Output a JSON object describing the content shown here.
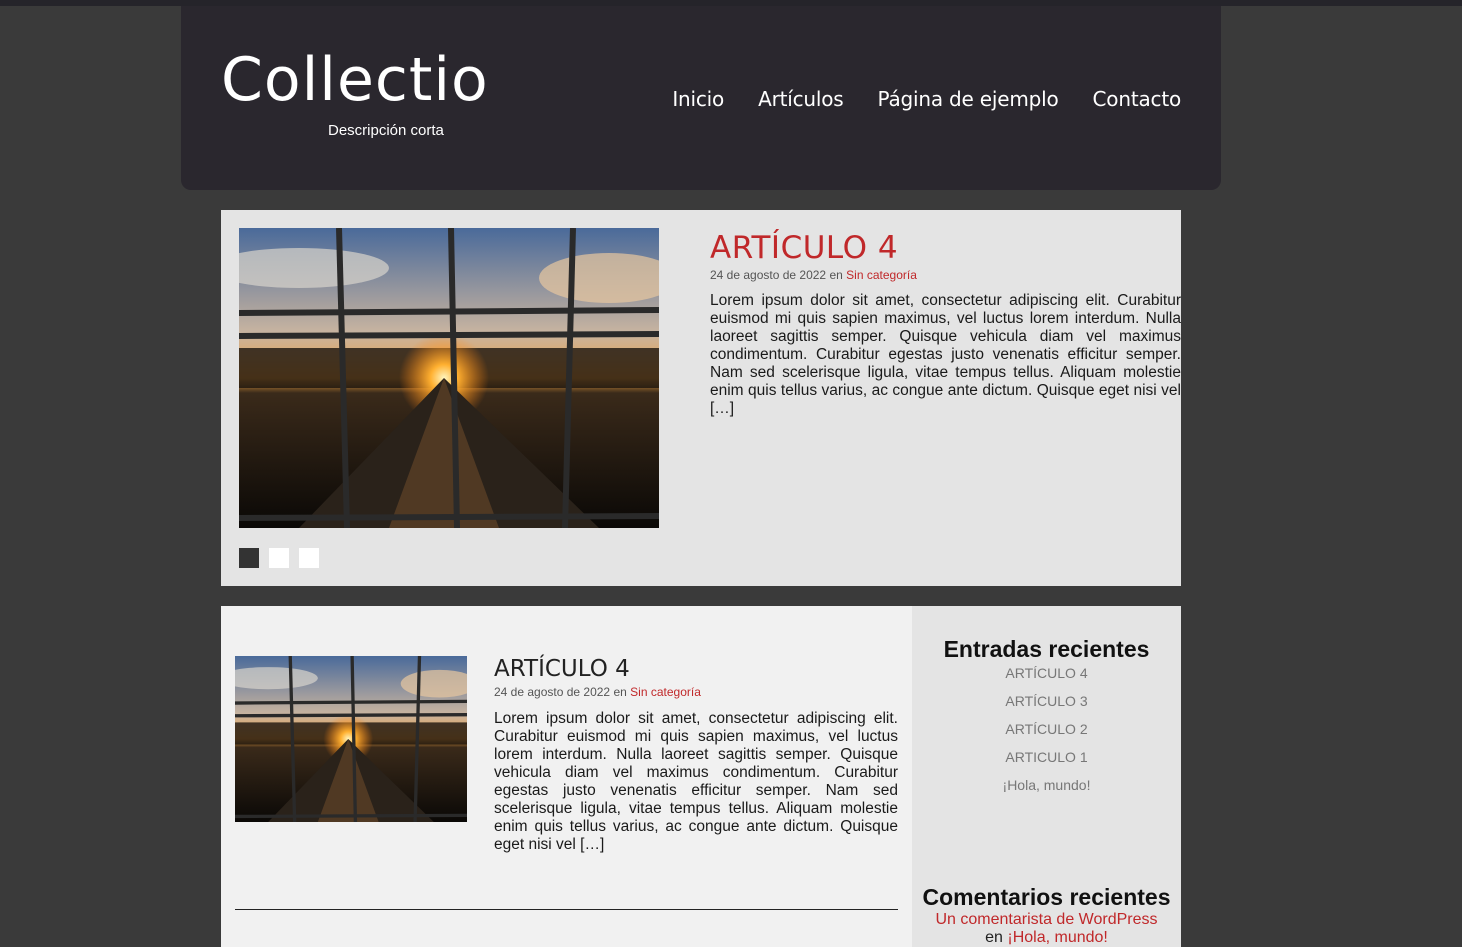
{
  "site": {
    "title": "Collectio",
    "description": "Descripción corta"
  },
  "nav": {
    "items": [
      "Inicio",
      "Artículos",
      "Página de ejemplo",
      "Contacto"
    ]
  },
  "slider": {
    "title": "ARTÍCULO 4",
    "date": "24 de agosto de 2022",
    "meta_connector": "en",
    "category": "Sin categoría",
    "excerpt": "Lorem ipsum dolor sit amet, consectetur adipiscing elit. Curabitur euismod mi quis sapien maximus, vel luctus lorem interdum. Nulla laoreet sagittis semper. Quisque vehicula diam vel maximus condimentum. Curabitur egestas justo venenatis efficitur semper. Nam sed scelerisque ligula, vitae tempus tellus. Aliquam molestie enim quis tellus varius, ac congue ante dictum. Quisque eget nisi vel […]",
    "dots": 3,
    "active_dot": 0
  },
  "post": {
    "title": "ARTÍCULO 4",
    "date": "24 de agosto de 2022",
    "meta_connector": "en",
    "category": "Sin categoría",
    "excerpt": "Lorem ipsum dolor sit amet, consectetur adipiscing elit. Curabitur euismod mi quis sapien maximus, vel luctus lorem interdum. Nulla laoreet sagittis semper. Quisque vehicula diam vel maximus condimentum. Curabitur egestas justo venenatis efficitur semper. Nam sed scelerisque ligula, vitae tempus tellus. Aliquam molestie enim quis tellus varius, ac congue ante dictum. Quisque eget nisi vel […]"
  },
  "sidebar": {
    "recent_title": "Entradas recientes",
    "recent_posts": [
      "ARTÍCULO 4",
      "ARTÍCULO 3",
      "ARTÍCULO 2",
      "ARTICULO 1",
      "¡Hola, mundo!"
    ],
    "comments_title": "Comentarios recientes",
    "comment_author": "Un comentarista de WordPress",
    "comment_connector": "en",
    "comment_post": "¡Hola, mundo!"
  },
  "colors": {
    "accent": "#c0282a",
    "header_bg": "#2a272e",
    "page_bg": "#3a3a3a"
  }
}
